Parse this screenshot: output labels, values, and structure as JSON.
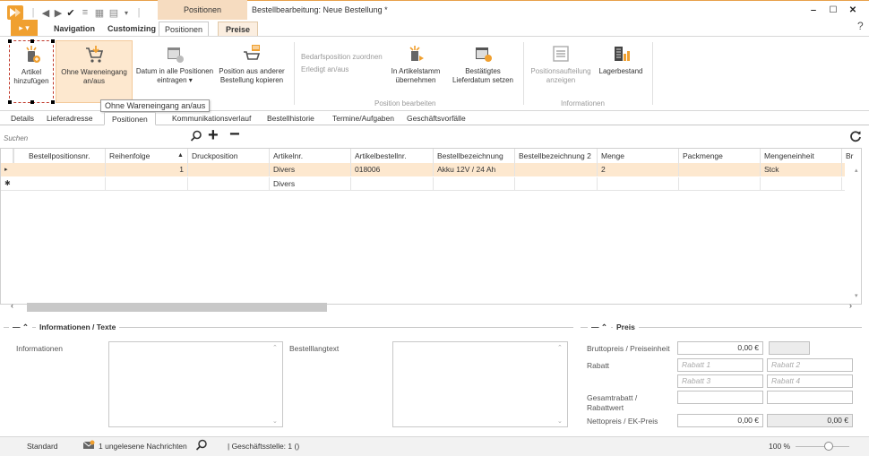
{
  "window": {
    "title": "Bestellbearbeitung: Neue Bestellung *",
    "context_tab_header": "Positionen",
    "help": "?",
    "minimize": "‒",
    "maximize": "☐",
    "close": "✕"
  },
  "ribbon_tabs": {
    "app_menu": "▸ ▾",
    "items": [
      "Navigation",
      "Customizing",
      "Positionen",
      "Preise"
    ],
    "active": "Positionen"
  },
  "ribbon": {
    "buttons": {
      "add": "Artikel hinzufügen",
      "ohne": "Ohne Wareneingang an/aus",
      "datum": "Datum in alle Positionen eintragen ▾",
      "position_kopieren": "Position aus anderer Bestellung kopieren",
      "bedarf": "Bedarfsposition zuordnen",
      "erledigt": "Erledigt an/aus",
      "artikelstamm": "In Artikelstamm übernehmen",
      "lieferdatum": "Bestätigtes Lieferdatum setzen",
      "aufteilung": "Positionsaufteilung anzeigen",
      "lagerbestand": "Lagerbestand"
    },
    "groups": {
      "bearbeiten": "Position bearbeiten",
      "informationen": "Informationen"
    },
    "tooltip": "Ohne Wareneingang an/aus"
  },
  "doc_tabs": [
    "Details",
    "Lieferadresse",
    "Positionen",
    "Kommunikationsverlauf",
    "Bestellhistorie",
    "Termine/Aufgaben",
    "Geschäftsvorfälle"
  ],
  "search": {
    "placeholder": "Suchen"
  },
  "grid": {
    "columns": [
      "Bestellpositionsnr.",
      "Reihenfolge",
      "Druckposition",
      "Artikelnr.",
      "Artikelbestellnr.",
      "Bestellbezeichnung",
      "Bestellbezeichnung 2",
      "Menge",
      "Packmenge",
      "Mengeneinheit",
      "Br"
    ],
    "rows": [
      [
        "",
        "1",
        "",
        "Divers",
        "018006",
        "Akku 12V / 24 Ah",
        "",
        "2",
        "",
        "Stck"
      ],
      [
        "",
        "",
        "",
        "Divers",
        "",
        "",
        "",
        "",
        "",
        ""
      ]
    ]
  },
  "info": {
    "title": "Informationen / Texte",
    "informationen": "Informationen",
    "bestelllangtext": "Bestelllangtext"
  },
  "preis": {
    "title": "Preis",
    "brutto_label": "Bruttopreis / Preiseinheit",
    "brutto_value": "0,00 €",
    "rabatt_label": "Rabatt",
    "rabatt1": "Rabatt 1",
    "rabatt2": "Rabatt 2",
    "rabatt3": "Rabatt 3",
    "rabatt4": "Rabatt 4",
    "gesamt_label": "Gesamtrabatt / Rabattwert",
    "netto_label": "Nettopreis / EK-Preis",
    "netto_value": "0,00 €",
    "netto_value2": "0,00 €"
  },
  "status": {
    "mode": "Standard",
    "messages": "1 ungelesene Nachrichten",
    "geschaeftsstelle": "| Geschäftsstelle: 1 ()",
    "zoom": "100 %"
  },
  "colors": {
    "accent": "#f0a030",
    "highlight": "#fde8cf",
    "selection_border": "#c0392b"
  }
}
